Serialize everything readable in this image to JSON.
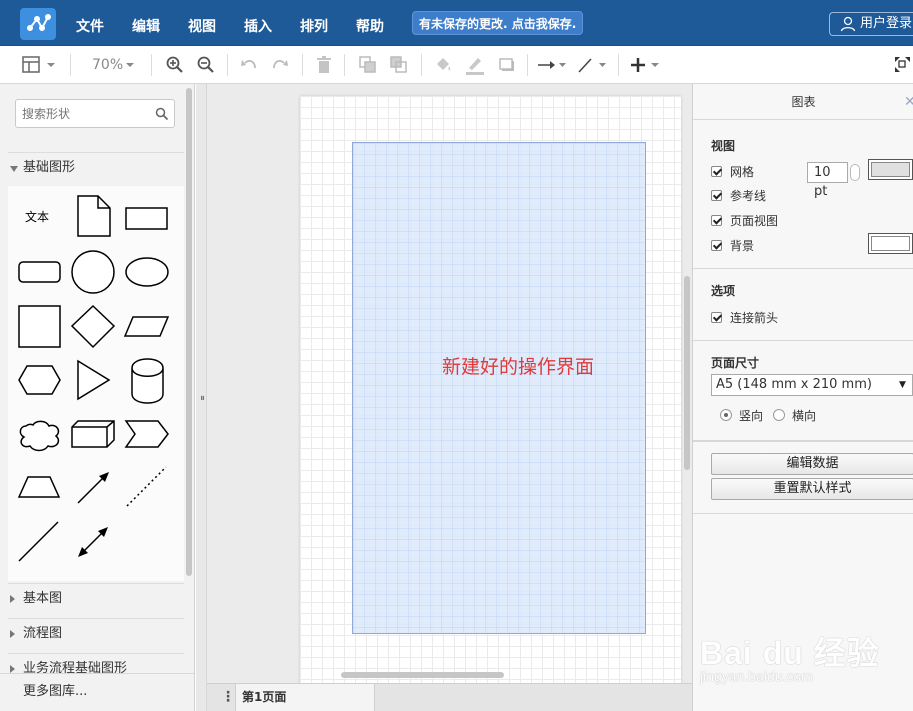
{
  "menubar": {
    "items": [
      "文件",
      "编辑",
      "视图",
      "插入",
      "排列",
      "帮助"
    ],
    "unsaved_notice": "有未保存的更改. 点击我保存.",
    "login": "用户登录"
  },
  "toolbar": {
    "zoom": "70%",
    "icons": [
      "page-view-icon",
      "zoom-in-icon",
      "zoom-out-icon",
      "undo-icon",
      "redo-icon",
      "delete-icon",
      "to-front-icon",
      "to-back-icon",
      "fill-color-icon",
      "line-color-icon",
      "shadow-icon",
      "connection-icon",
      "waypoints-icon",
      "insert-icon",
      "fullscreen-icon"
    ]
  },
  "sidebar": {
    "search_placeholder": "搜索形状",
    "sections": [
      {
        "label": "基础图形",
        "open": true
      },
      {
        "label": "基本图",
        "open": false
      },
      {
        "label": "流程图",
        "open": false
      },
      {
        "label": "业务流程基础图形",
        "open": false
      }
    ],
    "text_shape_label": "文本",
    "more_libraries": "更多图库..."
  },
  "canvas": {
    "text": "新建好的操作界面"
  },
  "pagebar": {
    "menu": "⋮",
    "tab": "第1页面"
  },
  "panel": {
    "title": "图表",
    "view": {
      "heading": "视图",
      "grid": "网格",
      "grid_size": "10 pt",
      "guides": "参考线",
      "page_view": "页面视图",
      "background": "背景"
    },
    "options": {
      "heading": "选项",
      "connection_arrows": "连接箭头"
    },
    "page_size": {
      "heading": "页面尺寸",
      "selected": "A5 (148 mm x 210 mm)",
      "portrait": "竖向",
      "landscape": "横向"
    },
    "buttons": {
      "edit_data": "编辑数据",
      "reset_style": "重置默认样式"
    }
  },
  "watermark": {
    "main": "Bai du 经验",
    "sub": "jingyan.baidu.com"
  },
  "colors": {
    "menubar": "#1f5a98",
    "canvas_text": "#e03a3a",
    "shape_fill": "#dae8fc"
  }
}
